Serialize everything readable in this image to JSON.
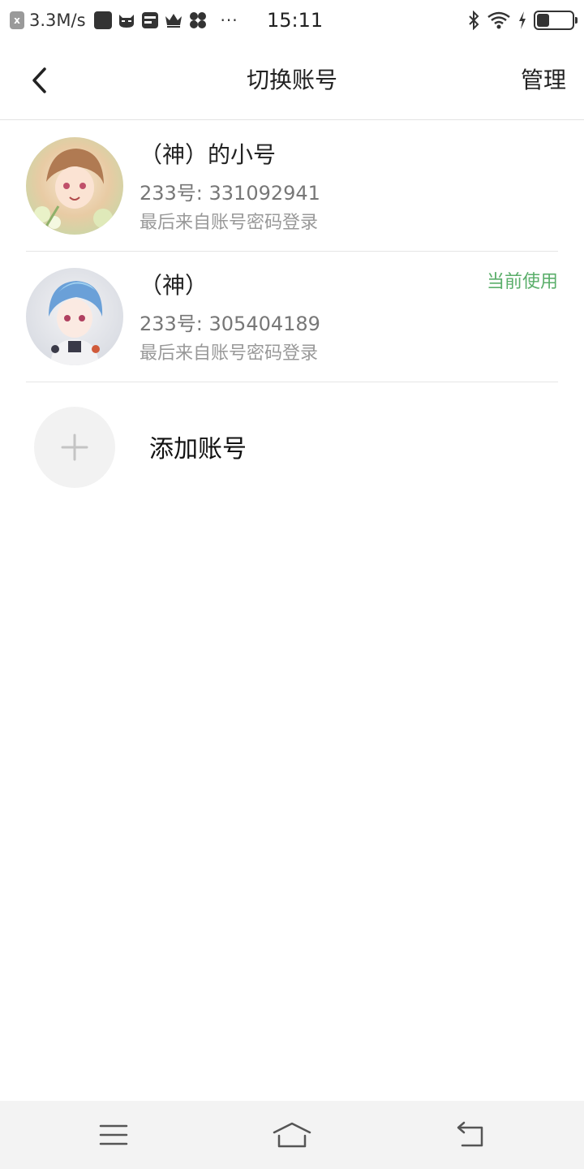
{
  "status_bar": {
    "notification_box": "x",
    "speed": "3.3M/s",
    "more": "···",
    "time": "15:11",
    "battery_level": 0.35
  },
  "nav": {
    "title": "切换账号",
    "manage_label": "管理",
    "back_icon": "chevron-left-icon"
  },
  "accounts": [
    {
      "name": "（神）的小号",
      "id_text": "233号: 331092941",
      "login_text": "最后来自账号密码登录",
      "badge": ""
    },
    {
      "name": "（神）",
      "id_text": "233号: 305404189",
      "login_text": "最后来自账号密码登录",
      "badge": "当前使用"
    }
  ],
  "add_account": {
    "label": "添加账号",
    "icon": "plus-icon"
  },
  "colors": {
    "accent_green": "#5aae6a",
    "divider": "#e6e6e6",
    "sys_nav_bg": "#f3f3f3"
  }
}
